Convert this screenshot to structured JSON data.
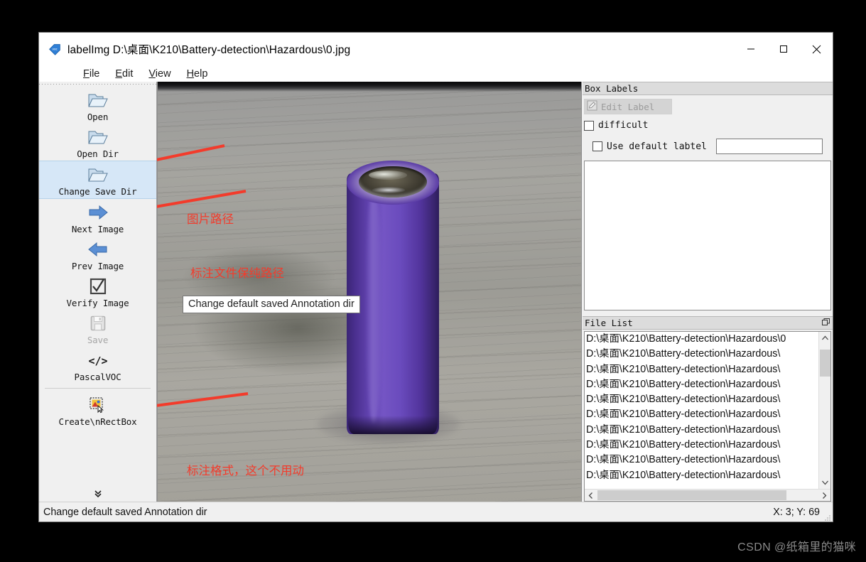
{
  "window": {
    "title": "labelImg D:\\桌面\\K210\\Battery-detection\\Hazardous\\0.jpg",
    "app_icon": "tag-icon",
    "controls": {
      "minimize": "—",
      "maximize": "▢",
      "close": "✕"
    }
  },
  "menubar": {
    "items": [
      {
        "name": "file",
        "label": "File",
        "mnemonic": "F",
        "rest": "ile"
      },
      {
        "name": "edit",
        "label": "Edit",
        "mnemonic": "E",
        "rest": "dit"
      },
      {
        "name": "view",
        "label": "View",
        "mnemonic": "V",
        "rest": "iew"
      },
      {
        "name": "help",
        "label": "Help",
        "mnemonic": "H",
        "rest": "elp"
      }
    ]
  },
  "toolbar": {
    "items": [
      {
        "name": "open",
        "label": "Open",
        "icon": "open-folder-icon",
        "state": "normal"
      },
      {
        "name": "open-dir",
        "label": "Open Dir",
        "icon": "open-folder-icon",
        "state": "normal"
      },
      {
        "name": "change-save-dir",
        "label": "Change Save Dir",
        "icon": "open-folder-icon",
        "state": "selected"
      },
      {
        "name": "next-image",
        "label": "Next Image",
        "icon": "arrow-right-icon",
        "state": "normal"
      },
      {
        "name": "prev-image",
        "label": "Prev Image",
        "icon": "arrow-left-icon",
        "state": "normal"
      },
      {
        "name": "verify-image",
        "label": "Verify Image",
        "icon": "checkbox-tick-icon",
        "state": "normal"
      },
      {
        "name": "save",
        "label": "Save",
        "icon": "floppy-disk-icon",
        "state": "disabled"
      },
      {
        "name": "format",
        "label": "PascalVOC",
        "icon": "code-tags-icon",
        "state": "normal"
      },
      {
        "name": "create-rect-box",
        "label": "Create\\nRectBox",
        "icon": "create-rect-icon",
        "state": "normal"
      }
    ],
    "overflow_icon": "double-chevron-down-icon"
  },
  "tooltip": {
    "text": "Change default saved Annotation dir"
  },
  "annotations": {
    "accent_color": "#f33b2b",
    "items": [
      {
        "name": "annotation-image-path",
        "text": "图片路径"
      },
      {
        "name": "annotation-save-path",
        "text": "标注文件保纯路径"
      },
      {
        "name": "annotation-format",
        "text": "标注格式，这个不用动"
      }
    ]
  },
  "box_labels": {
    "title": "Box Labels",
    "edit_label_button": "Edit Label",
    "edit_label_icon": "pencil-edit-icon",
    "difficult_checkbox": {
      "label": "difficult",
      "checked": false
    },
    "use_default_checkbox": {
      "label": "Use default labtel",
      "checked": false
    },
    "default_label_value": "",
    "default_label_placeholder": ""
  },
  "file_list": {
    "title": "File List",
    "float_icon": "undock-icon",
    "items": [
      "D:\\桌面\\K210\\Battery-detection\\Hazardous\\0",
      "D:\\桌面\\K210\\Battery-detection\\Hazardous\\",
      "D:\\桌面\\K210\\Battery-detection\\Hazardous\\",
      "D:\\桌面\\K210\\Battery-detection\\Hazardous\\",
      "D:\\桌面\\K210\\Battery-detection\\Hazardous\\",
      "D:\\桌面\\K210\\Battery-detection\\Hazardous\\",
      "D:\\桌面\\K210\\Battery-detection\\Hazardous\\",
      "D:\\桌面\\K210\\Battery-detection\\Hazardous\\",
      "D:\\桌面\\K210\\Battery-detection\\Hazardous\\",
      "D:\\桌面\\K210\\Battery-detection\\Hazardous\\"
    ],
    "scroll_up_icon": "chevron-up-icon",
    "scroll_down_icon": "chevron-down-icon",
    "scroll_left_icon": "chevron-left-icon",
    "scroll_right_icon": "chevron-right-icon"
  },
  "statusbar": {
    "message": "Change default saved Annotation dir",
    "coords": "X: 3; Y: 69"
  },
  "watermark": {
    "text": "CSDN @纸箱里的猫咪"
  }
}
